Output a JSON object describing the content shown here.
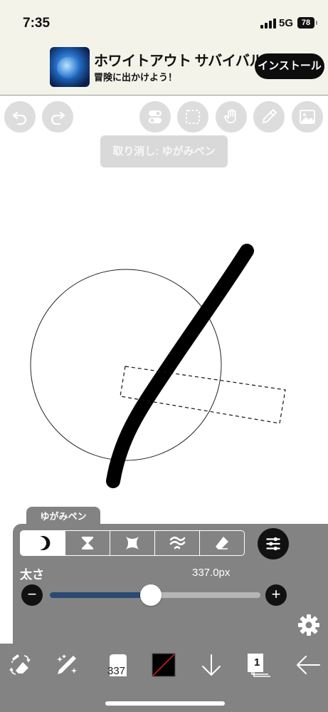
{
  "status_bar": {
    "time": "7:35",
    "network": "5G",
    "battery": "78"
  },
  "ad": {
    "title": "ホワイトアウト サバイバル",
    "subtitle": "冒険に出かけよう！",
    "install_label": "インストール",
    "image_icon": "globe-game-art"
  },
  "toolbar": {
    "undo_icon": "undo-icon",
    "redo_icon": "redo-icon",
    "tools": [
      "toggle-icon",
      "selection-icon",
      "hand-icon",
      "eyedropper-icon",
      "image-icon"
    ]
  },
  "undo_toast": "取り消し: ゆがみペン",
  "brush_panel": {
    "tab_label": "ゆがみペン",
    "modes": [
      "moon-icon",
      "hourglass-icon",
      "pinch-icon",
      "wave-icon",
      "eraser-icon"
    ],
    "active_mode": 0,
    "size_label": "太さ",
    "size_value": "337.0px",
    "slider_fraction": 0.48,
    "minus_label": "−",
    "plus_label": "+"
  },
  "bottom_bar": {
    "brush_size_badge": "337",
    "layer_number": "1",
    "color": "#000000"
  },
  "colors": {
    "panel": "#838383",
    "toolbar_button": "#dddddd",
    "slider_fill": "#2a4a72",
    "ad_background": "#f3f3e9"
  }
}
